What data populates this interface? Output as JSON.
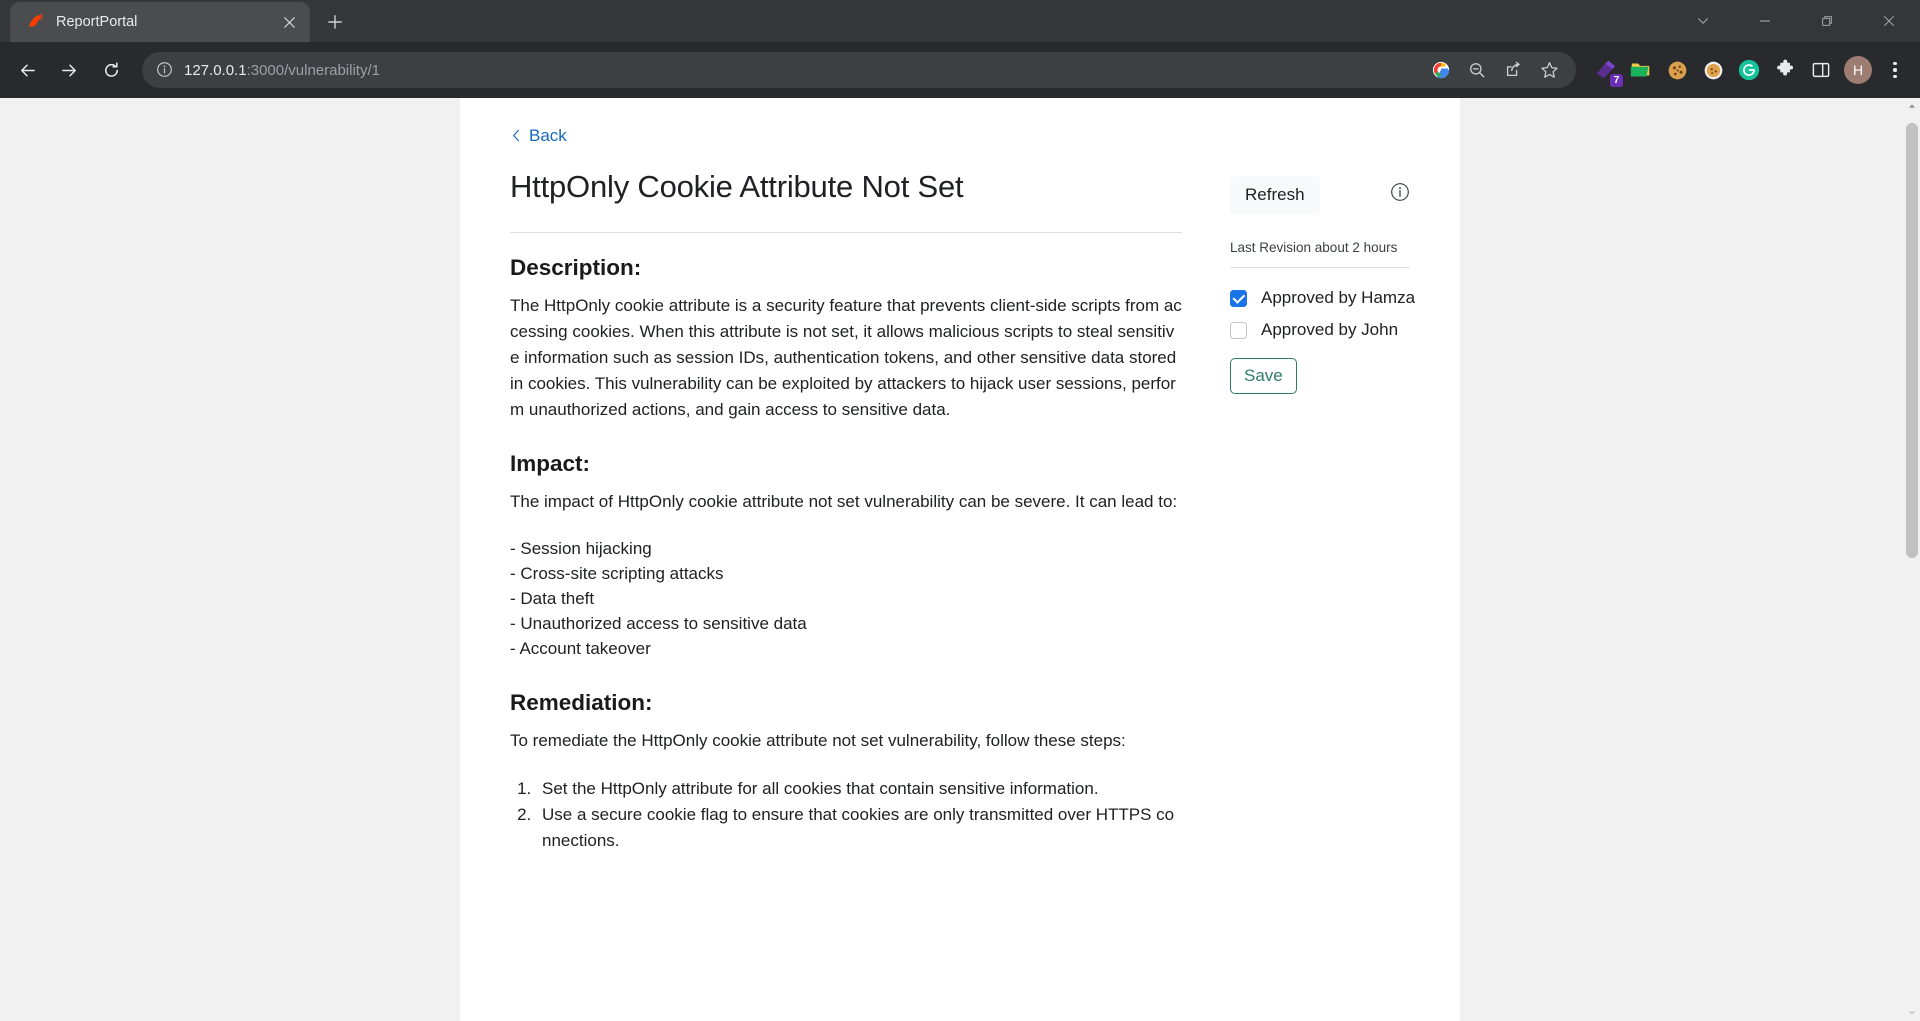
{
  "browser": {
    "tab": {
      "title": "ReportPortal",
      "favicon_icon": "reportportal-logo-icon",
      "close_icon": "close-icon"
    },
    "new_tab_icon": "plus-icon",
    "window_controls": [
      {
        "name": "chevron-down-icon",
        "glyph": "∨"
      },
      {
        "name": "minimize-icon",
        "glyph": "–"
      },
      {
        "name": "restore-icon",
        "glyph": "❐"
      },
      {
        "name": "close-icon",
        "glyph": "×"
      }
    ],
    "nav": {
      "back_icon": "arrow-left-icon",
      "forward_icon": "arrow-right-icon",
      "reload_icon": "reload-icon"
    },
    "omnibox": {
      "site_info_icon": "info-circle-icon",
      "url_host": "127.0.0.1",
      "url_path": ":3000/vulnerability/1",
      "actions": [
        {
          "name": "google-lens-icon"
        },
        {
          "name": "zoom-out-icon"
        },
        {
          "name": "share-icon"
        },
        {
          "name": "bookmark-star-icon"
        }
      ]
    },
    "extensions": [
      {
        "name": "eraser-extension-icon",
        "badge": "7"
      },
      {
        "name": "folder-extension-icon",
        "badge": ""
      },
      {
        "name": "cookie-extension-icon",
        "badge": ""
      },
      {
        "name": "cookie-editor-extension-icon",
        "badge": ""
      },
      {
        "name": "grammarly-extension-icon",
        "badge": ""
      },
      {
        "name": "puzzle-extensions-icon",
        "badge": ""
      },
      {
        "name": "side-panel-icon",
        "badge": ""
      }
    ],
    "profile_initial": "H",
    "menu_icon": "kebab-menu-icon"
  },
  "page": {
    "back_label": "Back",
    "title": "HttpOnly Cookie Attribute Not Set",
    "sections": {
      "description_heading": "Description:",
      "description_body": "The HttpOnly cookie attribute is a security feature that prevents client-side scripts from accessing cookies. When this attribute is not set, it allows malicious scripts to steal sensitive information such as session IDs, authentication tokens, and other sensitive data stored in cookies. This vulnerability can be exploited by attackers to hijack user sessions, perform unauthorized actions, and gain access to sensitive data.",
      "impact_heading": "Impact:",
      "impact_body": "The impact of HttpOnly cookie attribute not set vulnerability can be severe. It can lead to:",
      "impact_items": [
        "- Session hijacking",
        "- Cross-site scripting attacks",
        "- Data theft",
        "- Unauthorized access to sensitive data",
        "- Account takeover"
      ],
      "remediation_heading": "Remediation:",
      "remediation_body": "To remediate the HttpOnly cookie attribute not set vulnerability, follow these steps:",
      "remediation_steps": [
        "Set the HttpOnly attribute for all cookies that contain sensitive information.",
        "Use a secure cookie flag to ensure that cookies are only transmitted over HTTPS connections."
      ]
    },
    "sidebar": {
      "refresh_label": "Refresh",
      "info_icon": "info-circle-icon",
      "revision_text": "Last Revision about 2 hours",
      "approvals": [
        {
          "label": "Approved by Hamza",
          "checked": true
        },
        {
          "label": "Approved by John",
          "checked": false
        }
      ],
      "save_label": "Save"
    }
  },
  "colors": {
    "link": "#1669c1",
    "checkbox_on": "#1a73e8",
    "save_accent": "#2e7d6b",
    "chrome_tabstrip": "#35363a",
    "chrome_toolbar": "#292a2d",
    "page_bg": "#f1f1f1"
  }
}
